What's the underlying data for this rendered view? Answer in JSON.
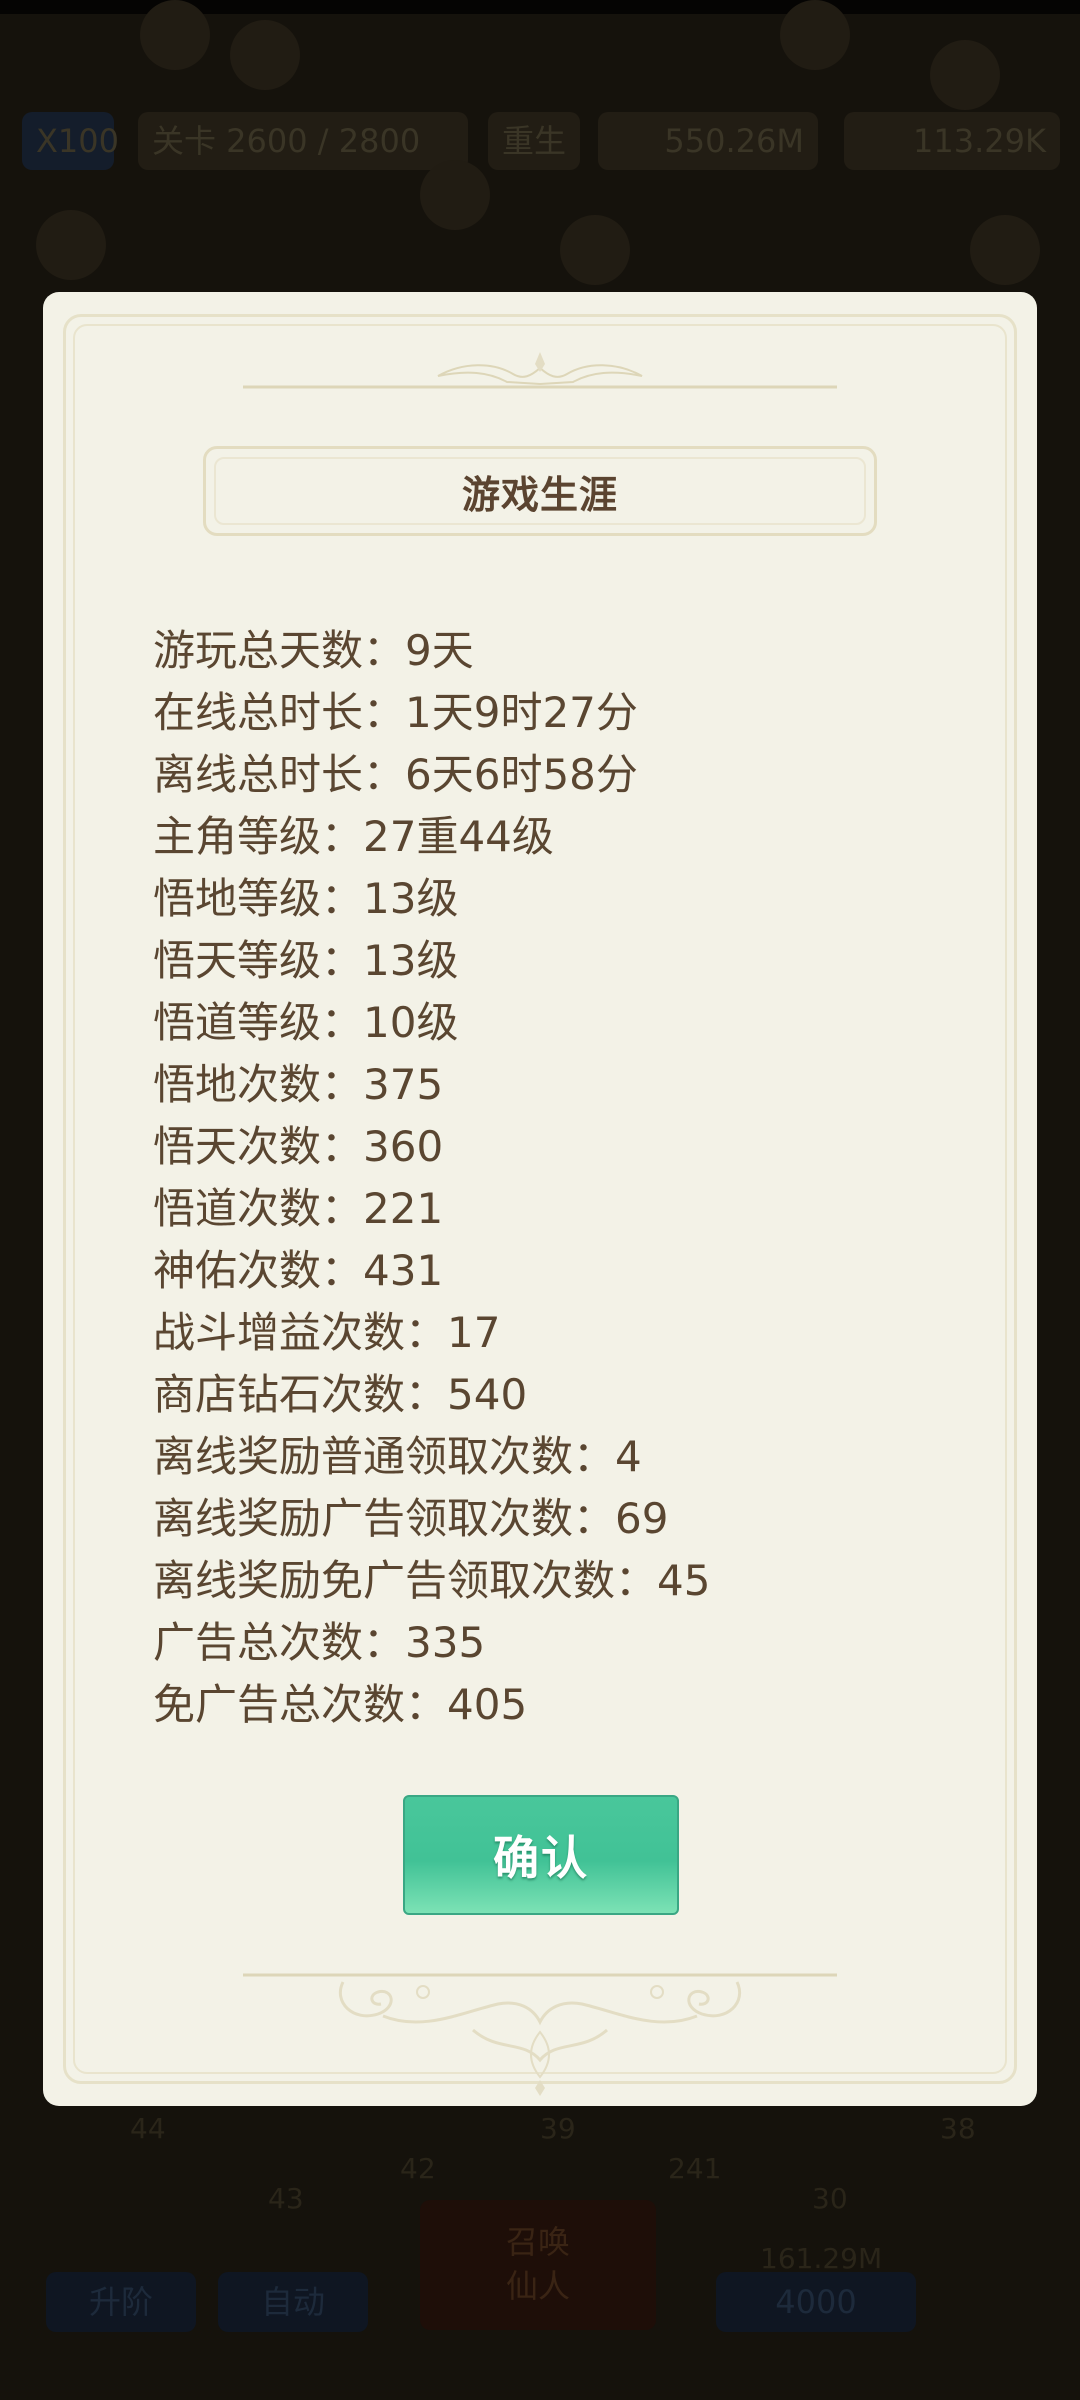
{
  "background": {
    "speed": "X100",
    "stage": "关卡 2600 / 2800",
    "rebirth": "重生",
    "gold": "550.26M",
    "gems": "113.29K",
    "levels": [
      "44",
      "43",
      "42",
      "39",
      "241",
      "30",
      "38"
    ],
    "upgrade": "升阶",
    "auto": "自动",
    "summon": "召唤",
    "summon_sub": "仙人",
    "bottom_cost": "161.29M",
    "bottom_count": "4000"
  },
  "dialog": {
    "title": "游戏生涯",
    "stats": [
      "游玩总天数：9天",
      "在线总时长：1天9时27分",
      "离线总时长：6天6时58分",
      "主角等级：27重44级",
      "悟地等级：13级",
      "悟天等级：13级",
      "悟道等级：10级",
      "悟地次数：375",
      "悟天次数：360",
      "悟道次数：221",
      "神佑次数：431",
      "战斗增益次数：17",
      "商店钻石次数：540",
      "离线奖励普通领取次数：4",
      "离线奖励广告领取次数：69",
      "离线奖励免广告领取次数：45",
      "广告总次数：335",
      "免广告总次数：405"
    ],
    "confirm_label": "确认"
  },
  "colors": {
    "dialog_bg": "#f3f2e7",
    "text": "#5a4631",
    "button": "#45c498",
    "ornament": "#ded8bd"
  }
}
